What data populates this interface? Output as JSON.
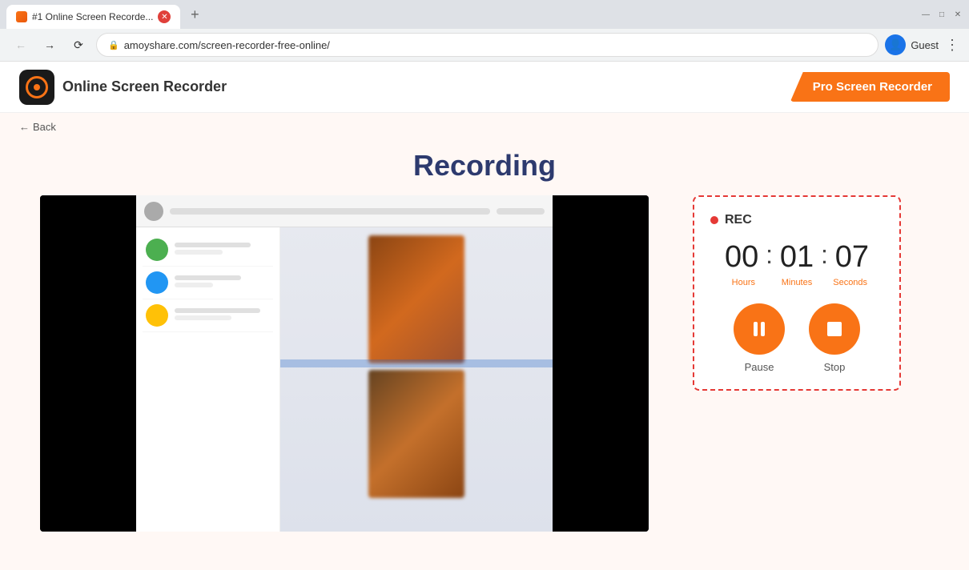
{
  "browser": {
    "tab_title": "#1 Online Screen Recorde...",
    "url": "amoyshare.com/screen-recorder-free-online/",
    "user": "Guest",
    "new_tab": "+"
  },
  "header": {
    "logo_text": "Online Screen Recorder",
    "pro_btn": "Pro Screen Recorder"
  },
  "back_link": "Back",
  "page": {
    "title": "Recording"
  },
  "rec_panel": {
    "rec_label": "REC",
    "hours": "00",
    "minutes": "01",
    "seconds": "07",
    "hours_label": "Hours",
    "minutes_label": "Minutes",
    "seconds_label": "Seconds",
    "pause_label": "Pause",
    "stop_label": "Stop"
  },
  "colors": {
    "accent": "#f97316",
    "red": "#e53935",
    "blue": "#2d3a6e"
  }
}
